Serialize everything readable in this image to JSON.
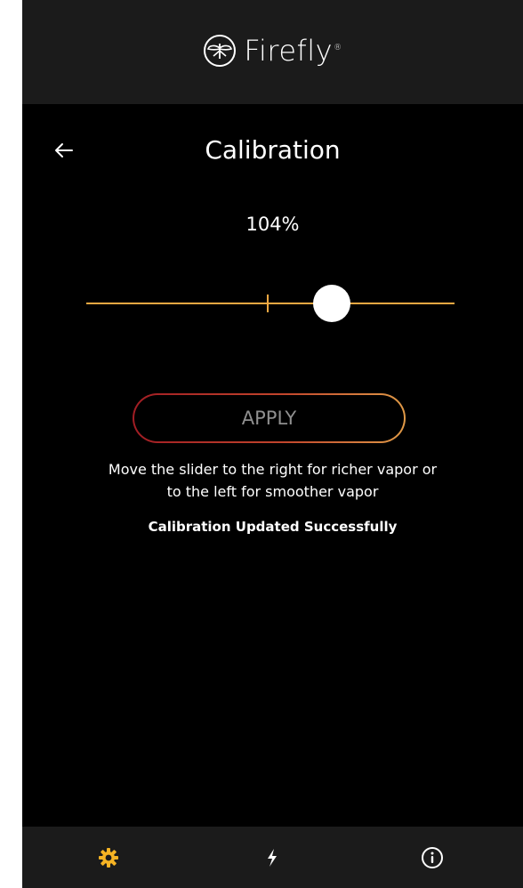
{
  "header": {
    "brand": "Firefly",
    "brand_mark": "®",
    "logo_icon": "firefly-logo-icon"
  },
  "page": {
    "title": "Calibration",
    "back_icon": "arrow-left-icon"
  },
  "calibration": {
    "value_label": "104%",
    "slider": {
      "value_percent": 104,
      "default_percent": 100,
      "track_color": "#f0a842",
      "thumb_color": "#ffffff"
    }
  },
  "apply_button": {
    "label": "APPLY",
    "gradient_start": "#a11d24",
    "gradient_end": "#e09a47"
  },
  "help": {
    "line1": "Move the slider to the right for richer vapor or",
    "line2": "to the left for smoother vapor"
  },
  "status": {
    "message": "Calibration Updated Successfully"
  },
  "bottom_nav": {
    "items": [
      {
        "icon": "gear-icon",
        "active": true,
        "color": "#f5b324"
      },
      {
        "icon": "lightning-icon",
        "active": false,
        "color": "#ffffff"
      },
      {
        "icon": "info-icon",
        "active": false,
        "color": "#ffffff"
      }
    ]
  },
  "colors": {
    "background": "#000000",
    "header_bg": "#1b1b1b",
    "accent": "#f0a842"
  }
}
